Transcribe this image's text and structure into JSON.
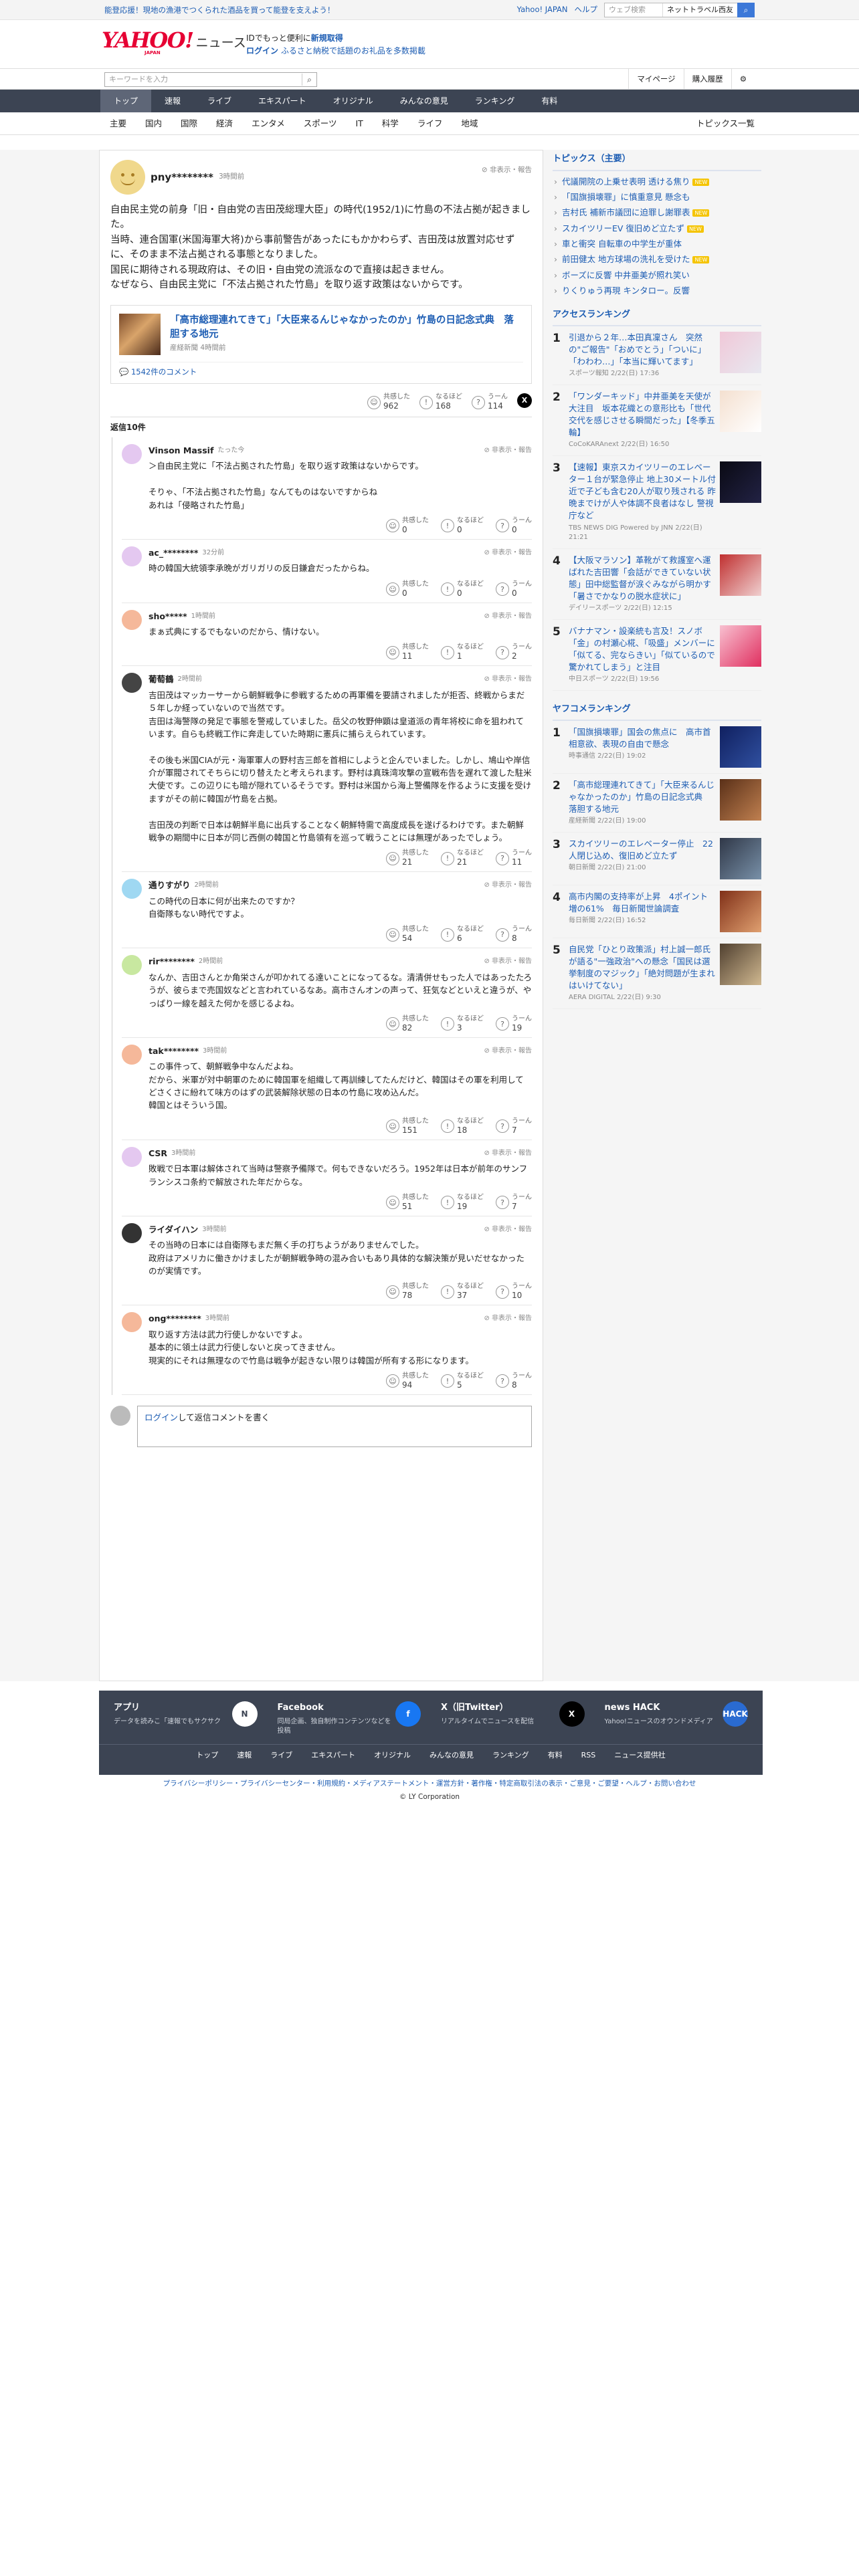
{
  "topbar": {
    "promo": "能登応援！現地の漁港でつくられた酒品を買って能登を支えよう！",
    "links": [
      "Yahoo! JAPAN",
      "ヘルプ"
    ],
    "search_placeholder": "ウェブ検索",
    "search_scope": "ネットトラベル西友"
  },
  "logo": {
    "yahoo": "YAHOO!",
    "japan": "JAPAN",
    "news": "ニュース"
  },
  "header_promo": {
    "line1": "IDでもっと便利に",
    "line1_link": "新規取得",
    "line2_link": "ログイン",
    "line2": "ふるさと納税で話題のお礼品を多数掲載"
  },
  "toolbar": {
    "keyword_placeholder": "キーワードを入力",
    "right": [
      "マイページ",
      "購入履歴",
      "⚙"
    ]
  },
  "nav": [
    "トップ",
    "速報",
    "ライブ",
    "エキスパート",
    "オリジナル",
    "みんなの意見",
    "ランキング",
    "有料"
  ],
  "subnav": [
    "主要",
    "国内",
    "国際",
    "経済",
    "エンタメ",
    "スポーツ",
    "IT",
    "科学",
    "ライフ",
    "地域"
  ],
  "subnav_all": "トピックス一覧",
  "post": {
    "user": "pny********",
    "time": "3時間前",
    "report": "非表示・報告",
    "body": "自由民主党の前身「旧・自由党の吉田茂総理大臣」の時代(1952/1)に竹島の不法占拠が起きました。\n当時、連合国軍(米国海軍大将)から事前警告があったにもかかわらず、吉田茂は放置対応せずに、そのまま不法占拠される事態となりました。\n国民に期待される現政府は、その旧・自由党の流派なので直接は起きません。\nなぜなら、自由民主党に「不法占拠された竹島」を取り返す政策はないからです。",
    "card": {
      "title": "「高市総理連れてきて」「大臣来るんじゃなかったのか」竹島の日記念式典　落胆する地元",
      "source": "産経新聞 4時間前",
      "comments": "1542件のコメント"
    },
    "reactions": {
      "agree_label": "共感した",
      "agree": "962",
      "insight_label": "なるほど",
      "insight": "168",
      "hmm_label": "うーん",
      "hmm": "114"
    }
  },
  "reply_count": "返信10件",
  "replies": [
    {
      "name": "Vinson Massif",
      "time": "たった今",
      "text": "＞自由民主党に「不法占拠された竹島」を取り返す政策はないからです。\n\nそりゃ、「不法占拠された竹島」なんてものはないですからね\nあれは「侵略された竹島」",
      "a": "0",
      "b": "0",
      "c": "0",
      "color": "#e4c8f0"
    },
    {
      "name": "ac_********",
      "time": "32分前",
      "text": "時の韓国大統領李承晩がガリガリの反日鎌倉だったからね。",
      "a": "0",
      "b": "0",
      "c": "0",
      "color": "#e4c8f0"
    },
    {
      "name": "sho*****",
      "time": "1時間前",
      "text": "まぁ式典にするでもないのだから、情けない。",
      "a": "11",
      "b": "1",
      "c": "2",
      "color": "#f5b89a"
    },
    {
      "name": "葡萄鶴",
      "time": "2時間前",
      "text": "吉田茂はマッカーサーから朝鮮戦争に参戦するための再軍備を要請されましたが拒否、終戦からまだ５年しか経っていないので当然です。\n吉田は海警隊の発足で事態を警戒していました。岳父の牧野伸顕は皇道派の青年将校に命を狙われています。自らも終戦工作に奔走していた時期に憲兵に捕らえられています。\n\nその後も米国CIAが元・海軍軍人の野村吉三郎を首相にしようと企んでいました。しかし、鳩山や岸信介が軍閥されてそちらに切り替えたと考えられます。野村は真珠湾攻撃の宣戦布告を遅れて渡した駐米大使です。この辺りにも暗が隠れているそうです。野村は米国から海上警備隊を作るように支援を受けますがその前に韓国が竹島を占拠。\n\n吉田茂の判断で日本は朝鮮半島に出兵することなく朝鮮特需で高度成長を遂げるわけです。また朝鮮戦争の期間中に日本が同じ西側の韓国と竹島領有を巡って戦うことには無理があったでしょう。",
      "a": "21",
      "b": "21",
      "c": "11",
      "color": "#444444"
    },
    {
      "name": "通りすがり",
      "time": "2時間前",
      "text": "この時代の日本に何が出来たのですか？\n自衛隊もない時代ですよ。",
      "a": "54",
      "b": "6",
      "c": "8",
      "color": "#9fd8f2"
    },
    {
      "name": "rir********",
      "time": "2時間前",
      "text": "なんか、吉田さんとか角栄さんが叩かれてる達いことになってるな。清清併せもった人ではあったたろうが、彼らまで売国奴などと言われているなあ。高市さんオンの声って、狂気などといえと違うが、やっぱり一線を越えた何かを感じるよね。",
      "a": "82",
      "b": "3",
      "c": "19",
      "color": "#c8e8a0"
    },
    {
      "name": "tak********",
      "time": "3時間前",
      "text": "この事件って、朝鮮戦争中なんだよね。\nだから、米軍が対中朝軍のために韓国軍を組織して再訓練してたんだけど、韓国はその軍を利用してどさくさに紛れて味方のはずの武装解除状態の日本の竹島に攻め込んだ。\n韓国とはそういう国。",
      "a": "151",
      "b": "18",
      "c": "7",
      "color": "#f5b89a"
    },
    {
      "name": "CSR",
      "time": "3時間前",
      "text": "敗戦で日本軍は解体されて当時は警察予備隊で。何もできないだろう。1952年は日本が前年のサンフランシスコ条約で解放された年だからな。",
      "a": "51",
      "b": "19",
      "c": "7",
      "color": "#e4c8f0"
    },
    {
      "name": "ライダイハン",
      "time": "3時間前",
      "text": "その当時の日本には自衛隊もまだ無く手の打ちようがありませんでした。\n政府はアメリカに働きかけましたが朝鮮戦争時の混み合いもあり具体的な解決策が見いだせなかったのが実情です。",
      "a": "78",
      "b": "37",
      "c": "10",
      "color": "#333333"
    },
    {
      "name": "ong********",
      "time": "3時間前",
      "text": "取り返す方法は武力行使しかないですよ。\n基本的に領土は武力行使しないと戻ってきません。\n現実的にそれは無理なので竹島は戦争が起きない限りは韓国が所有する形になります。",
      "a": "94",
      "b": "5",
      "c": "8",
      "color": "#f5b89a"
    }
  ],
  "comment_box": {
    "login": "ログイン",
    "text": "して返信コメントを書く"
  },
  "side": {
    "topics_title": "トピックス（主要）",
    "topics": [
      {
        "t": "代議開院の上乗せ表明 透ける焦り",
        "n": true
      },
      {
        "t": "「国旗損壊罪」に慎重意見 懸念も",
        "n": false
      },
      {
        "t": "吉村氏 補新市議団に迫罪し謝罪表",
        "n": true
      },
      {
        "t": "スカイツリーEV 復旧めど立たず",
        "n": true
      },
      {
        "t": "車と衝突 自転車の中学生が重体",
        "n": false
      },
      {
        "t": "前田健太 地方球場の洗礼を受けた",
        "n": true
      },
      {
        "t": "ボーズに反響 中井亜美が照れ笑い",
        "n": false
      },
      {
        "t": "りくりゅう再現 キンタロー。反響",
        "n": false
      }
    ],
    "access_title": "アクセスランキング",
    "access": [
      {
        "t": "引退から２年…本田真凜さん　突然の\"ご報告\"「おめでとう」「ついに」「わわわ…」「本当に輝いてます」",
        "s": "スポーツ報知 2/22(日) 17:36",
        "c1": "#f0c8d8",
        "c2": "#e8e8f0"
      },
      {
        "t": "「ワンダーキッド」中井亜美を天使が大注目　坂本花織との意形比も「世代交代を感じさせる瞬間だった」【冬季五輪】",
        "s": "CoCoKARAnext 2/22(日) 16:50",
        "c1": "#f4e0d0",
        "c2": "#fff"
      },
      {
        "t": "【速報】東京スカイツリーのエレベーター１台が緊急停止 地上30メートル付近で子ども含む20人が取り残される 昨晩までけが人や体調不良者はなし 警視庁など",
        "s": "TBS NEWS DIG Powered by JNN 2/22(日) 21:21",
        "c1": "#0a0a14",
        "c2": "#224"
      },
      {
        "t": "【大阪マラソン】革靴がて救護室へ運ばれた吉田響「会話ができていない状態」田中総監督が涙ぐみながら明かす「暑さでかなりの脱水症状に」",
        "s": "デイリースポーツ 2/22(日) 12:15",
        "c1": "#c03030",
        "c2": "#f0d0d0"
      },
      {
        "t": "バナナマン・設楽統も言及！スノボ「金」の村瀬心椛、「吸盛」メンバーに「似てる、完ならきい」「似ているので驚かれてしまう」と注目",
        "s": "中日スポーツ 2/22(日) 19:56",
        "c1": "#f8c0d0",
        "c2": "#e03060"
      }
    ],
    "yafoko_title": "ヤフコメランキング",
    "yafoko": [
      {
        "t": "「国旗損壊罪」国会の焦点に　高市首相意欲、表現の自由で懸念",
        "s": "時事通信 2/22(日) 19:02",
        "c1": "#102060",
        "c2": "#3050a0"
      },
      {
        "t": "「高市総理連れてきて」「大臣来るんじゃなかったのか」竹島の日記念式典　落胆する地元",
        "s": "産経新聞 2/22(日) 19:00",
        "c1": "#5a3018",
        "c2": "#c08050"
      },
      {
        "t": "スカイツリーのエレベーター停止　22人閉じ込め、復旧めど立たず",
        "s": "朝日新聞 2/22(日) 21:00",
        "c1": "#303848",
        "c2": "#7890a8"
      },
      {
        "t": "高市内閣の支持率が上昇　4ポイント増の61%　毎日新聞世論調査",
        "s": "毎日新聞 2/22(日) 16:52",
        "c1": "#803018",
        "c2": "#e0a070"
      },
      {
        "t": "自民党「ひとり政策派」村上誠一郎氏が語る\"一強政治\"への懸念「国民は選挙制度のマジック」「絶対問題が生まれはいけてない」",
        "s": "AERA DIGITAL 2/22(日) 9:30",
        "c1": "#504030",
        "c2": "#d0b890"
      }
    ]
  },
  "footer": {
    "cols": [
      {
        "t": "アプリ",
        "d": "データを読みこ「速報でもサクサク",
        "icon": "N"
      },
      {
        "t": "Facebook",
        "d": "同局企画、独自制作コンテンツなどを投稿",
        "icon": "f"
      },
      {
        "t": "X（旧Twitter）",
        "d": "リアルタイムでニュースを配信",
        "icon": "X"
      },
      {
        "t": "news HACK",
        "d": "Yahoo!ニュースのオウンドメディア",
        "icon": "HACK"
      }
    ],
    "links": [
      "トップ",
      "速報",
      "ライブ",
      "エキスパート",
      "オリジナル",
      "みんなの意見",
      "ランキング",
      "有料",
      "RSS",
      "ニュース提供社"
    ],
    "legal": "プライバシーポリシー・プライバシーセンター・利用規約・メディアステートメント・運営方針・著作権・特定商取引法の表示・ご意見・ご要望・ヘルプ・お問い合わせ",
    "copy": "© LY Corporation"
  },
  "colors": {
    "brand": "#e60033",
    "link": "#1d5db3",
    "nav": "#3c4453"
  }
}
